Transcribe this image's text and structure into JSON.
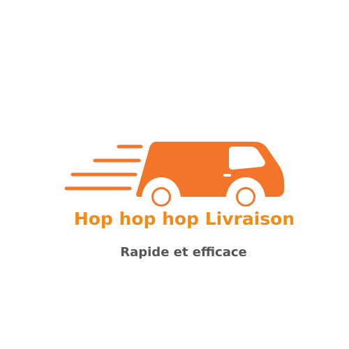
{
  "logo": {
    "icon": "delivery-van-icon",
    "brand_name": "Hop hop hop Livraison",
    "tagline": "Rapide et efficace"
  },
  "colors": {
    "van": "#f27529",
    "brand_text": "#f58a13",
    "tagline_text": "#555555",
    "background": "#ffffff"
  }
}
